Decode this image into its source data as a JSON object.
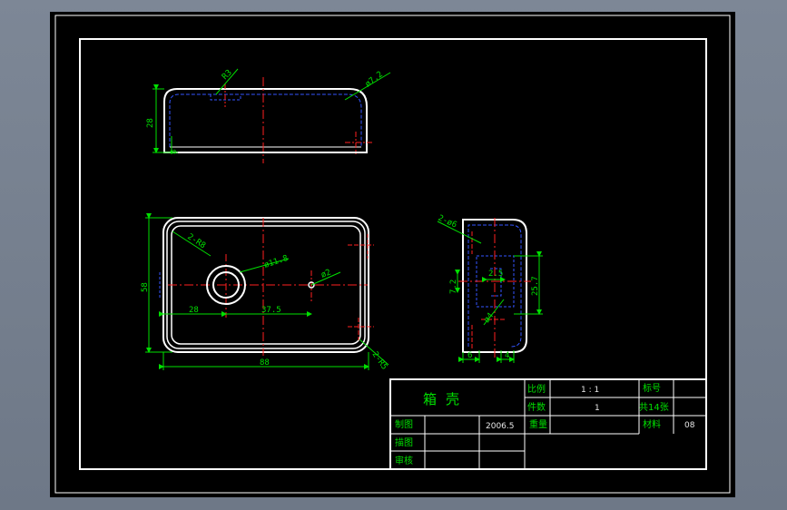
{
  "drawing": {
    "views": {
      "top": {
        "dims": {
          "r_small": "R3",
          "r_big": "ø7.2",
          "height": "28",
          "small": "8"
        }
      },
      "front": {
        "dims": {
          "r_corner": "2-R8",
          "hole": "ø11.8",
          "small_hole": "ø2",
          "dist_a": "28",
          "dist_b": "37.5",
          "height": "58",
          "width": "88",
          "r_corner_b": "2-R5"
        }
      },
      "side": {
        "dims": {
          "holes": "2-ø6",
          "gap": "2.5",
          "h_small": "7.2",
          "h_big": "25.7",
          "dia": "ø4",
          "w_a": "6",
          "w_b": "4"
        }
      }
    },
    "title_block": {
      "part_name": "箱壳",
      "labels": {
        "scale": "比例",
        "quantity": "件数",
        "weight": "重量",
        "drawn": "制图",
        "traced": "描图",
        "checked": "审核",
        "material": "材料",
        "mark": "标号"
      },
      "values": {
        "scale": "1 : 1",
        "quantity": "1",
        "sheets": "共14张",
        "date": "2006.5",
        "material": "08"
      }
    }
  }
}
